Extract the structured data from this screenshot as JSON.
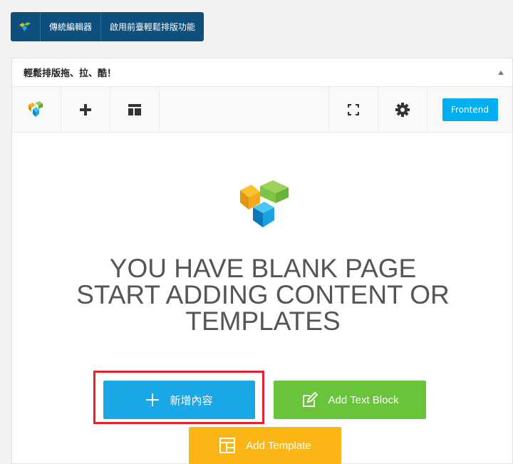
{
  "switch_bar": {
    "classic_editor_label": "傳統編輯器",
    "enable_frontend_label": "啟用前臺輕鬆排版功能"
  },
  "panel": {
    "title": "輕鬆排版拖、拉、酷！",
    "frontend_label": "Frontend"
  },
  "blank_page": {
    "line1": "YOU HAVE BLANK PAGE",
    "line2": "START ADDING CONTENT OR",
    "line3": "TEMPLATES"
  },
  "buttons": {
    "add_element": "新增內容",
    "add_text_block": "Add Text Block",
    "add_template": "Add Template"
  },
  "colors": {
    "switch_bar": "#0e4f7e",
    "frontend": "#00aff0",
    "add_element": "#19a7e8",
    "add_text_block": "#69c33b",
    "add_template": "#fbb514",
    "highlight": "#e2222c"
  }
}
